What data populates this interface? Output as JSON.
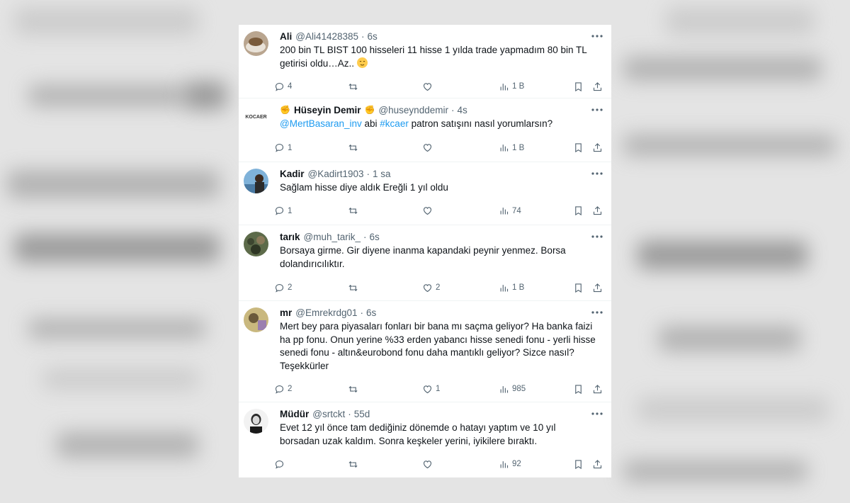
{
  "tweets": [
    {
      "name": "Ali",
      "handle": "@Ali41428385",
      "time": "6s",
      "text_parts": [
        "200 bin TL BIST 100 hisseleri 11 hisse 1 yılda trade yapmadım 80 bin TL getirisi oldu…Az.."
      ],
      "replies": "4",
      "retweets": "",
      "likes": "",
      "views": "1 B"
    },
    {
      "name": "Hüseyin Demir",
      "handle": "@huseynddemir",
      "time": "4s",
      "mention": "@MertBasaran_inv",
      "text_mid": " abi ",
      "hashtag": "#kcaer",
      "text_end": " patron satışını nasıl yorumlarsın?",
      "avatar_text": "KOCAER",
      "replies": "1",
      "retweets": "",
      "likes": "",
      "views": "1 B"
    },
    {
      "name": "Kadir",
      "handle": "@Kadirt1903",
      "time": "1 sa",
      "text": "Sağlam hisse diye aldık Ereğli 1 yıl oldu",
      "replies": "1",
      "retweets": "",
      "likes": "",
      "views": "74"
    },
    {
      "name": "tarık",
      "handle": "@muh_tarik_",
      "time": "6s",
      "text": "Borsaya girme. Gir diyene inanma kapandaki peynir yenmez. Borsa dolandırıcılıktır.",
      "replies": "2",
      "retweets": "",
      "likes": "2",
      "views": "1 B"
    },
    {
      "name": "mr",
      "handle": "@Emrekrdg01",
      "time": "6s",
      "text": "Mert bey para piyasaları fonları bir bana mı saçma geliyor? Ha banka faizi ha pp fonu. Onun yerine %33 erden yabancı hisse senedi fonu - yerli hisse senedi fonu - altın&eurobond fonu daha mantıklı geliyor? Sizce nasıl? Teşekkürler",
      "replies": "2",
      "retweets": "",
      "likes": "1",
      "views": "985"
    },
    {
      "name": "Müdür",
      "handle": "@srtckt",
      "time": "55d",
      "text": "Evet 12 yıl önce tam dediğiniz dönemde o hatayı yaptım ve 10 yıl borsadan uzak kaldım. Sonra keşkeler yerini, iyikilere bıraktı.",
      "replies": "",
      "retweets": "",
      "likes": "",
      "views": "92"
    }
  ],
  "separator": "·",
  "colors": {
    "text": "#0f1419",
    "secondary": "#536471",
    "link": "#1d9bf0",
    "divider": "#eff3f4"
  },
  "icons": [
    "reply-icon",
    "retweet-icon",
    "like-icon",
    "views-icon",
    "bookmark-icon",
    "share-icon",
    "more-icon"
  ]
}
